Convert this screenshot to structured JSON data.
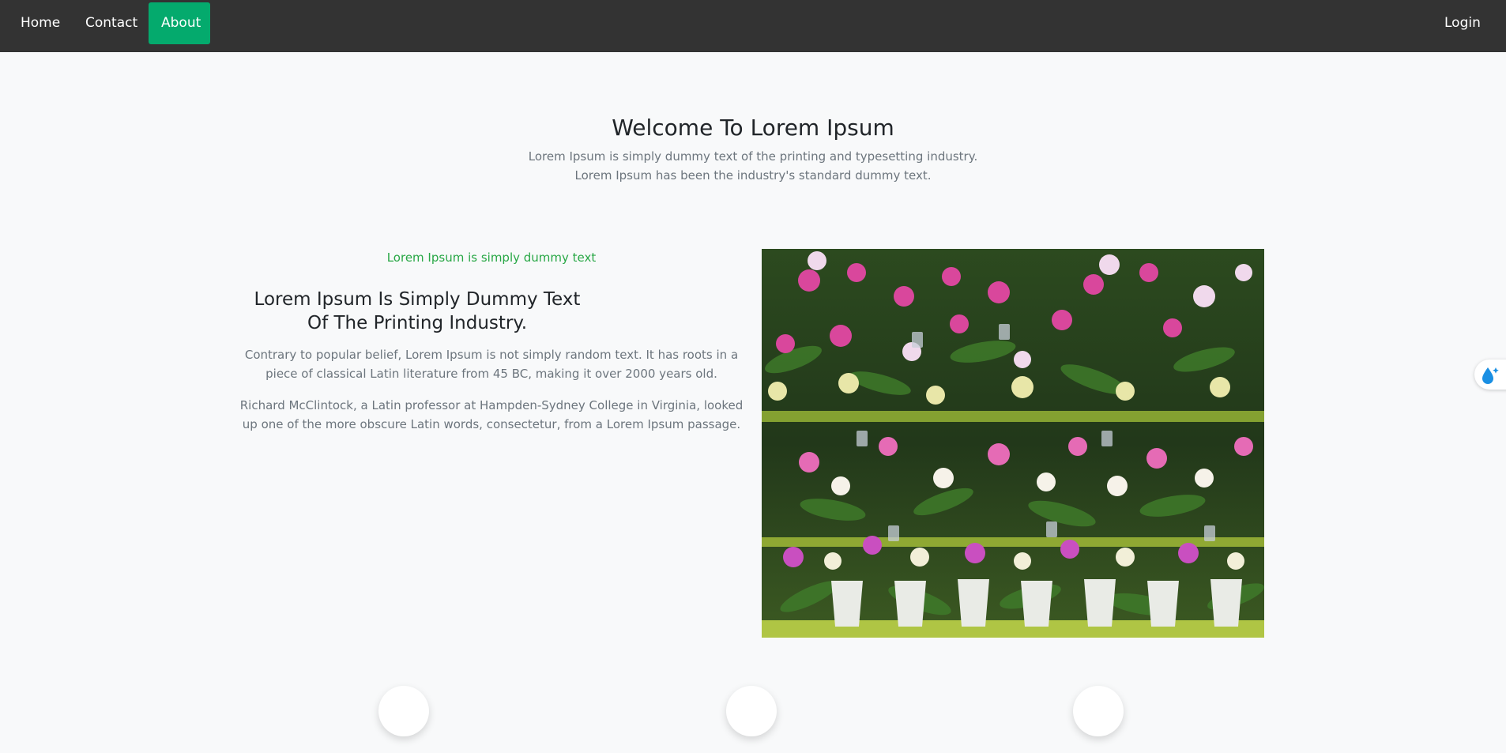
{
  "nav": {
    "items": [
      {
        "label": "Home",
        "active": false
      },
      {
        "label": "Contact",
        "active": false
      },
      {
        "label": "About",
        "active": true
      }
    ],
    "login_label": "Login",
    "background": "#333333",
    "active_color": "#04aa6d"
  },
  "hero": {
    "title": "Welcome To Lorem Ipsum",
    "line1": "Lorem Ipsum is simply dummy text of the printing and typesetting industry.",
    "line2": "Lorem Ipsum has been the industry's standard dummy text."
  },
  "about": {
    "kicker": "Lorem Ipsum is simply dummy text",
    "kicker_color": "#28a745",
    "heading": "Lorem Ipsum Is Simply Dummy Text Of The Printing Industry.",
    "paragraph1": "Contrary to popular belief, Lorem Ipsum is not simply random text. It has roots in a piece of classical Latin literature from 45 BC, making it over 2000 years old.",
    "paragraph2": "Richard McClintock, a Latin professor at Hampden-Sydney College in Virginia, looked up one of the more obscure Latin words, consectetur, from a Lorem Ipsum passage."
  },
  "image": {
    "subject": "orchid-flower-display"
  },
  "floating_widget": {
    "icon": "water-drop-sparkle-icon",
    "color": "#1a8fe3"
  },
  "feature_circles": {
    "count": 3
  }
}
